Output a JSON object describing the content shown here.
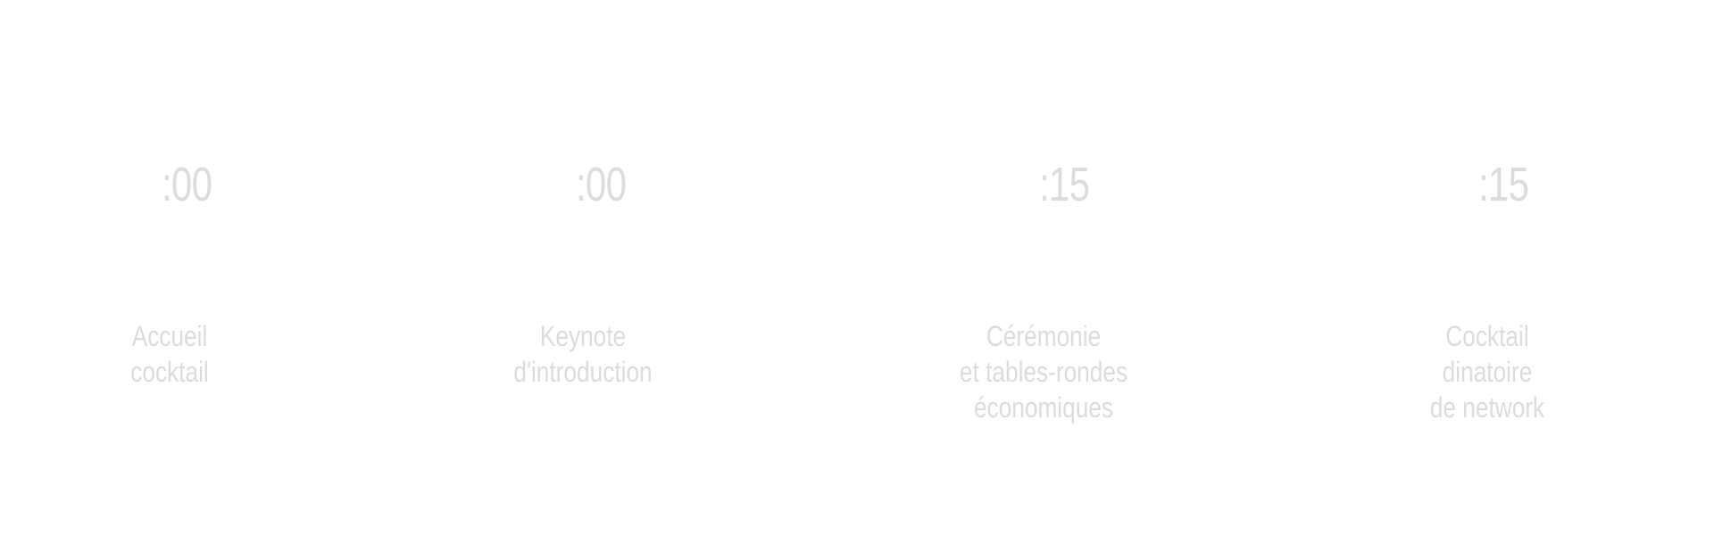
{
  "schedule": {
    "items": [
      {
        "time": ":00",
        "title": "Accueil\ncocktail"
      },
      {
        "time": ":00",
        "title": "Keynote\nd'introduction"
      },
      {
        "time": ":15",
        "title": "Cérémonie\net tables-rondes\néconomiques"
      },
      {
        "time": ":15",
        "title": "Cocktail\ndinatoire\nde network"
      }
    ]
  },
  "colors": {
    "background": "#ffffff",
    "text": "#dcdcdc"
  }
}
